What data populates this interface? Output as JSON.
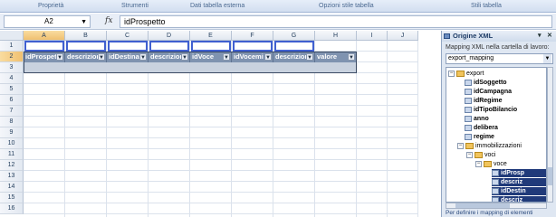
{
  "ribbon": {
    "groups": [
      "Proprietà",
      "Strumenti",
      "Dati tabella esterna",
      "Opzioni stile tabella",
      "Stili tabella"
    ]
  },
  "formula_bar": {
    "name_box": "A2",
    "fx": "fx",
    "content": "idProspetto"
  },
  "grid": {
    "columns": [
      "A",
      "B",
      "C",
      "D",
      "E",
      "F",
      "G",
      "H",
      "I",
      "J"
    ],
    "selected_column": "A",
    "rows": [
      "1",
      "2",
      "3",
      "4",
      "5",
      "6",
      "7",
      "8",
      "9",
      "10",
      "11",
      "12",
      "13",
      "14",
      "15",
      "16"
    ],
    "selected_row": "2",
    "table_headers": [
      "idProspet",
      "descrizior",
      "idDestina",
      "descrizior",
      "idVoce",
      "idVocemi",
      "descrizior",
      "valore"
    ]
  },
  "task_pane": {
    "title": "Origine XML",
    "label": "Mapping XML nella cartella di lavoro:",
    "mapping": "export_mapping",
    "tree": {
      "root": "export",
      "children": [
        "idSoggetto",
        "idCampagna",
        "idRegime",
        "idTipoBilancio",
        "anno",
        "delibera",
        "regime"
      ],
      "group": "immobilizzazioni",
      "subgroup": "voci",
      "item": "voce",
      "leaves": [
        "idProsp",
        "descriz",
        "idDestin",
        "descriz"
      ]
    },
    "footer": "Per definire i mapping di elementi"
  }
}
